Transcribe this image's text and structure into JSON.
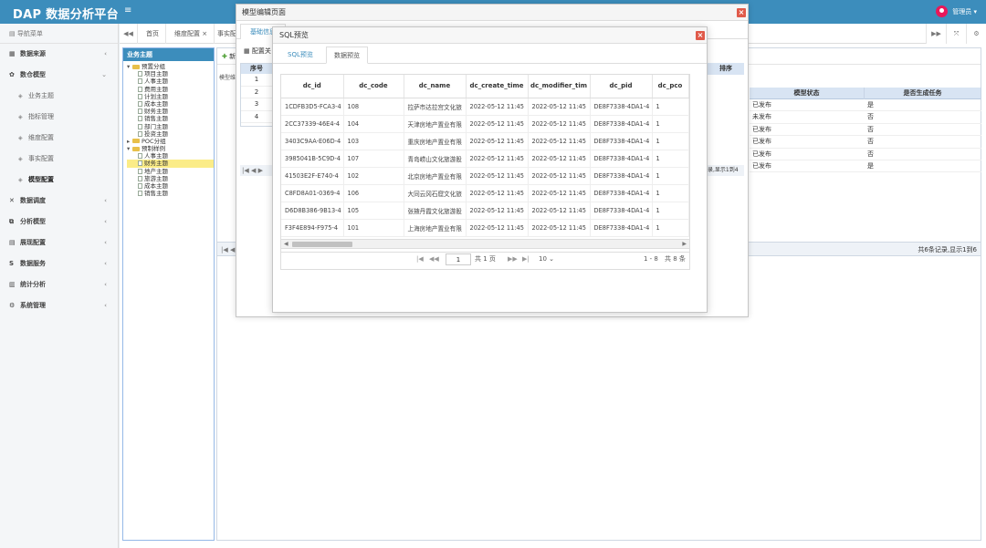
{
  "app": {
    "title": "DAP 数据分析平台",
    "menu_icon": "menu-icon",
    "user_name": "管理员 ▾"
  },
  "sidebar": {
    "header": "导航菜单",
    "items": [
      {
        "label": "数据来源",
        "icon": "▦"
      },
      {
        "label": "数仓模型",
        "icon": "✿",
        "expanded": true
      },
      {
        "label": "数据调度",
        "icon": "✕"
      },
      {
        "label": "分析模型",
        "icon": "⧉"
      },
      {
        "label": "展现配置",
        "icon": "▤"
      },
      {
        "label": "数据服务",
        "icon": "S"
      },
      {
        "label": "统计分析",
        "icon": "▥"
      },
      {
        "label": "系统管理",
        "icon": "⚙"
      }
    ],
    "subitems": [
      "业务主题",
      "指标管理",
      "维度配置",
      "事实配置",
      "模型配置"
    ],
    "active_sub": "模型配置"
  },
  "tabbar": {
    "tabs": [
      "首页",
      "维度配置 ×",
      "事实配"
    ]
  },
  "theme_panel": {
    "title": "业务主题",
    "tree": [
      {
        "label": "预置分组",
        "type": "folder",
        "level": 0
      },
      {
        "label": "项目主题",
        "type": "doc",
        "level": 1
      },
      {
        "label": "人事主题",
        "type": "doc",
        "level": 1
      },
      {
        "label": "费用主题",
        "type": "doc",
        "level": 1
      },
      {
        "label": "计划主题",
        "type": "doc",
        "level": 1
      },
      {
        "label": "成本主题",
        "type": "doc",
        "level": 1
      },
      {
        "label": "财务主题",
        "type": "doc",
        "level": 1
      },
      {
        "label": "销售主题",
        "type": "doc",
        "level": 1
      },
      {
        "label": "部门主题",
        "type": "doc",
        "level": 1
      },
      {
        "label": "投资主题",
        "type": "doc",
        "level": 1
      },
      {
        "label": "POC分组",
        "type": "folder",
        "level": 0,
        "collapsed": true
      },
      {
        "label": "预制样例",
        "type": "folder",
        "level": 0
      },
      {
        "label": "人事主题",
        "type": "doc",
        "level": 1
      },
      {
        "label": "财务主题",
        "type": "doc",
        "level": 1,
        "selected": true
      },
      {
        "label": "地产主题",
        "type": "doc",
        "level": 1
      },
      {
        "label": "旅游主题",
        "type": "doc",
        "level": 1
      },
      {
        "label": "成本主题",
        "type": "doc",
        "level": 1
      },
      {
        "label": "销售主题",
        "type": "doc",
        "level": 1
      }
    ]
  },
  "main_grid": {
    "toolbar_label": "新",
    "columns": [
      "模型状态",
      "是否生成任务"
    ],
    "rows": [
      {
        "status": "已发布",
        "task": "是"
      },
      {
        "status": "未发布",
        "task": "否"
      },
      {
        "status": "已发布",
        "task": "否"
      },
      {
        "status": "已发布",
        "task": "否"
      },
      {
        "status": "已发布",
        "task": "否"
      },
      {
        "status": "已发布",
        "task": "是"
      }
    ],
    "pager_text": "共6条记录,显示1到6",
    "pager_left": "|◀ ◀"
  },
  "model_modal": {
    "title": "模型编辑页面",
    "tab": "基础信息",
    "toolbar_label": "配置关",
    "grid_header": "序号",
    "grid_rows": [
      "1",
      "2",
      "3",
      "4"
    ],
    "left_label": "模型维",
    "right_header": "排序",
    "right_pager": "录,显示1到4",
    "pager_left": "|◀ ◀ ▶"
  },
  "sql_modal": {
    "title": "SQL预览",
    "tabs": [
      "SQL预览",
      "数据预览"
    ],
    "active_tab": "数据预览",
    "columns": [
      "dc_id",
      "dc_code",
      "dc_name",
      "dc_create_time",
      "dc_modifier_tim",
      "dc_pid",
      "dc_pco"
    ],
    "rows": [
      [
        "1CDFB3D5-FCA3-4",
        "108",
        "拉萨市达拉宫文化旅",
        "2022-05-12 11:45",
        "2022-05-12 11:45",
        "DE8F7338-4DA1-4",
        "1"
      ],
      [
        "2CC37339-46E4-4",
        "104",
        "天津房地产置业有限",
        "2022-05-12 11:45",
        "2022-05-12 11:45",
        "DE8F7338-4DA1-4",
        "1"
      ],
      [
        "3403C9AA-E06D-4",
        "103",
        "重庆房地产置业有限",
        "2022-05-12 11:45",
        "2022-05-12 11:45",
        "DE8F7338-4DA1-4",
        "1"
      ],
      [
        "3985041B-5C9D-4",
        "107",
        "青岛崂山文化旅游股",
        "2022-05-12 11:45",
        "2022-05-12 11:45",
        "DE8F7338-4DA1-4",
        "1"
      ],
      [
        "41503E2F-E740-4",
        "102",
        "北京房地产置业有限",
        "2022-05-12 11:45",
        "2022-05-12 11:45",
        "DE8F7338-4DA1-4",
        "1"
      ],
      [
        "C8FD8A01-0369-4",
        "106",
        "大同云冈石窟文化旅",
        "2022-05-12 11:45",
        "2022-05-12 11:45",
        "DE8F7338-4DA1-4",
        "1"
      ],
      [
        "D6D8B386-9B13-4",
        "105",
        "张掖丹霞文化旅游股",
        "2022-05-12 11:45",
        "2022-05-12 11:45",
        "DE8F7338-4DA1-4",
        "1"
      ],
      [
        "F3F4E894-F975-4",
        "101",
        "上海房地产置业有限",
        "2022-05-12 11:45",
        "2022-05-12 11:45",
        "DE8F7338-4DA1-4",
        "1"
      ]
    ],
    "pager": {
      "page": "1",
      "total_pages": "共 1 页",
      "page_size": "10 ⌄",
      "range": "1 - 8",
      "total": "共 8 条",
      "first": "|◀",
      "prev": "◀◀",
      "next": "▶▶",
      "last": "▶|"
    }
  }
}
